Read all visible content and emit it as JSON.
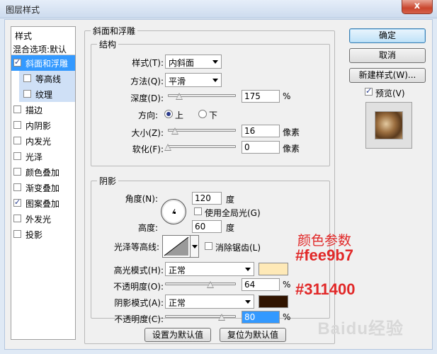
{
  "window": {
    "title": "图层样式",
    "close": "x"
  },
  "styles_panel": {
    "header": "样式",
    "blend_options": "混合选项:默认",
    "items": [
      {
        "label": "斜面和浮雕",
        "checked": true,
        "selected": true
      },
      {
        "label": "等高线",
        "checked": false,
        "sub": true
      },
      {
        "label": "纹理",
        "checked": false,
        "sub": true
      },
      {
        "label": "描边",
        "checked": false
      },
      {
        "label": "内阴影",
        "checked": false
      },
      {
        "label": "内发光",
        "checked": false
      },
      {
        "label": "光泽",
        "checked": false
      },
      {
        "label": "颜色叠加",
        "checked": false
      },
      {
        "label": "渐变叠加",
        "checked": false
      },
      {
        "label": "图案叠加",
        "checked": true
      },
      {
        "label": "外发光",
        "checked": false
      },
      {
        "label": "投影",
        "checked": false
      }
    ]
  },
  "bevel": {
    "title": "斜面和浮雕",
    "structure": {
      "title": "结构",
      "style_label": "样式(T):",
      "style_value": "内斜面",
      "technique_label": "方法(Q):",
      "technique_value": "平滑",
      "depth_label": "深度(D):",
      "depth_value": "175",
      "depth_unit": "%",
      "depth_slider": 0.17,
      "direction_label": "方向:",
      "direction_up": "上",
      "direction_down": "下",
      "size_label": "大小(Z):",
      "size_value": "16",
      "size_unit": "像素",
      "size_slider": 0.1,
      "soften_label": "软化(F):",
      "soften_value": "0",
      "soften_unit": "像素",
      "soften_slider": 0.0
    },
    "shading": {
      "title": "阴影",
      "angle_label": "角度(N):",
      "angle_value": "120",
      "angle_unit": "度",
      "global_light_label": "使用全局光(G)",
      "altitude_label": "高度:",
      "altitude_value": "60",
      "altitude_unit": "度",
      "gloss_label": "光泽等高线:",
      "antialias_label": "消除锯齿(L)",
      "highlight_label": "高光模式(H):",
      "highlight_mode": "正常",
      "highlight_color": "#fee9b7",
      "highlight_opacity_label": "不透明度(O):",
      "highlight_opacity": "64",
      "highlight_opacity_unit": "%",
      "highlight_slider": 0.64,
      "shadow_label": "阴影模式(A):",
      "shadow_mode": "正常",
      "shadow_color": "#311400",
      "shadow_opacity_label": "不透明度(C):",
      "shadow_opacity": "80",
      "shadow_opacity_unit": "%",
      "shadow_slider": 0.8
    },
    "make_default": "设置为默认值",
    "reset_default": "复位为默认值"
  },
  "right_panel": {
    "ok": "确定",
    "cancel": "取消",
    "new_style": "新建样式(W)...",
    "preview_label": "预览(V)"
  },
  "annotations": {
    "caption": "颜色参数",
    "highlight_hex": "#fee9b7",
    "shadow_hex": "#311400"
  },
  "watermark": "Baidu经验"
}
